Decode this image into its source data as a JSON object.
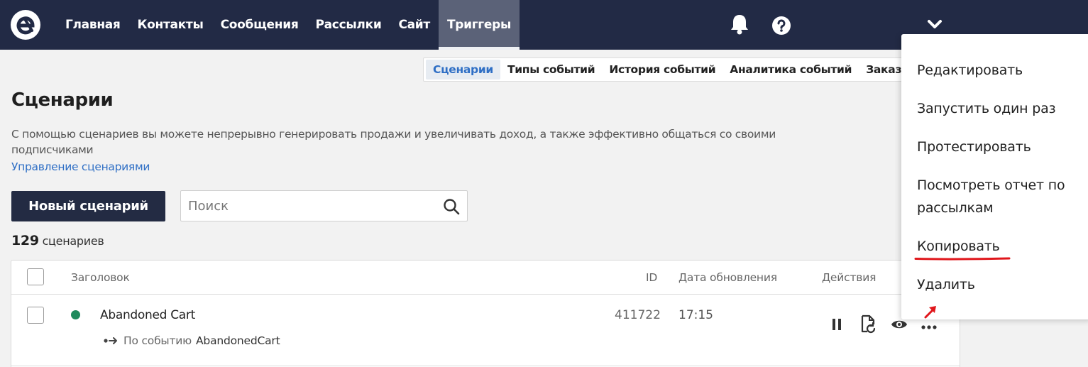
{
  "topnav": {
    "items": [
      "Главная",
      "Контакты",
      "Сообщения",
      "Рассылки",
      "Сайт",
      "Триггеры"
    ],
    "active_index": 5,
    "icons": [
      "logo-icon",
      "bell-icon",
      "help-icon",
      "chevron-down-icon"
    ]
  },
  "subnav": {
    "items": [
      "Сценарии",
      "Типы событий",
      "История событий",
      "Аналитика событий",
      "Заказ"
    ],
    "active_index": 0
  },
  "page": {
    "title": "Сценарии",
    "description": "С помощью сценариев вы можете непрерывно генерировать продажи и увеличивать доход, а также эффективно общаться со своими подписчиками",
    "manage_link": "Управление сценариями",
    "new_button": "Новый сценарий",
    "search_placeholder": "Поиск",
    "count_number": "129",
    "count_label": "сценариев"
  },
  "table": {
    "headers": {
      "title": "Заголовок",
      "id": "ID",
      "date": "Дата обновления",
      "actions": "Действия"
    },
    "rows": [
      {
        "title": "Abandoned Cart",
        "id": "411722",
        "date": "17:15",
        "trigger_label": "По событию",
        "trigger_event": "AbandonedCart",
        "status_color": "#1e8a5c",
        "action_icons": [
          "pause-icon",
          "file-refresh-icon",
          "eye-icon",
          "more-icon"
        ]
      }
    ]
  },
  "dropdown": {
    "items": [
      "Редактировать",
      "Запустить один раз",
      "Протестировать",
      "Посмотреть отчет по рассылкам",
      "Копировать",
      "Удалить"
    ]
  },
  "colors": {
    "topbar": "#222a45",
    "accent_link": "#2f6fc5",
    "primary_button": "#232b43",
    "annotation_red": "#e0161b"
  }
}
